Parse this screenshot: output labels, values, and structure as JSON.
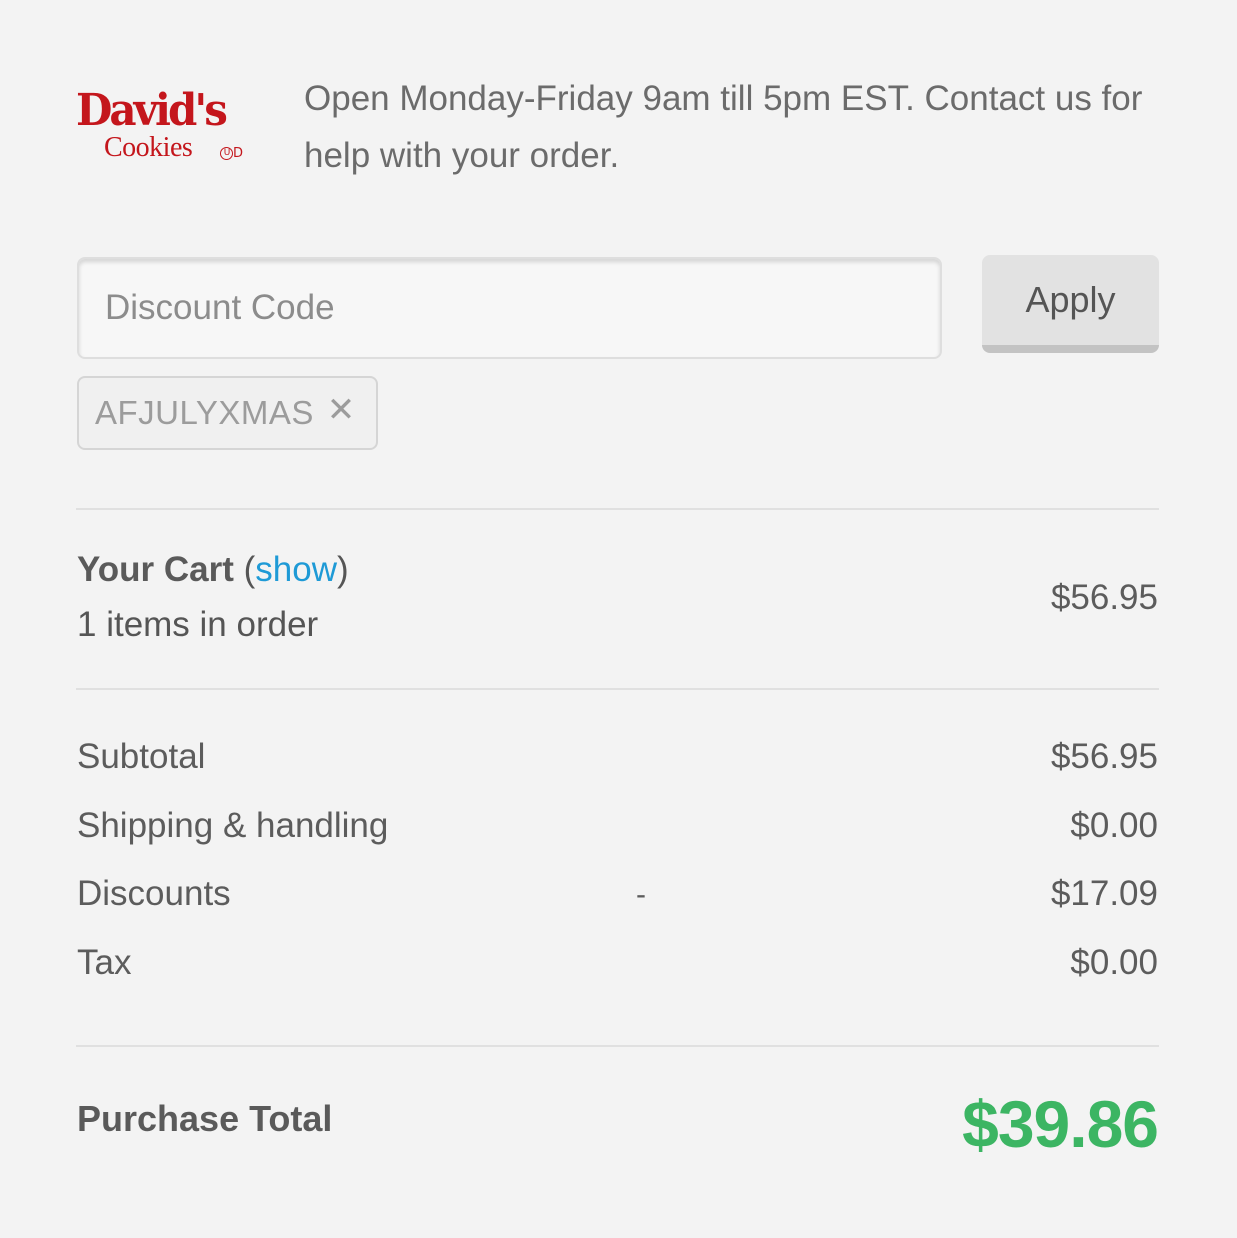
{
  "header": {
    "logo_brand": "David's",
    "logo_sub": "Cookies",
    "logo_mark": "OUD",
    "hours_text": "Open Monday-Friday 9am till 5pm EST. Contact us for help with your order."
  },
  "discount": {
    "placeholder": "Discount Code",
    "value": "",
    "apply_label": "Apply",
    "applied_code": "AFJULYXMAS",
    "remove_glyph": "✕"
  },
  "cart": {
    "title": "Your Cart",
    "show_link": "show",
    "items_text": "1 items in order",
    "price": "$56.95"
  },
  "summary": {
    "rows": [
      {
        "label": "Subtotal",
        "value": "$56.95"
      },
      {
        "label": "Shipping & handling",
        "value": "$0.00"
      },
      {
        "label": "Discounts",
        "prefix": "-",
        "value": "$17.09"
      },
      {
        "label": "Tax",
        "value": "$0.00"
      }
    ],
    "total_label": "Purchase Total",
    "total_value": "$39.86"
  },
  "colors": {
    "brand_red": "#c4161c",
    "link_blue": "#1e9ad6",
    "total_green": "#3cb563",
    "background": "#f3f3f3"
  }
}
